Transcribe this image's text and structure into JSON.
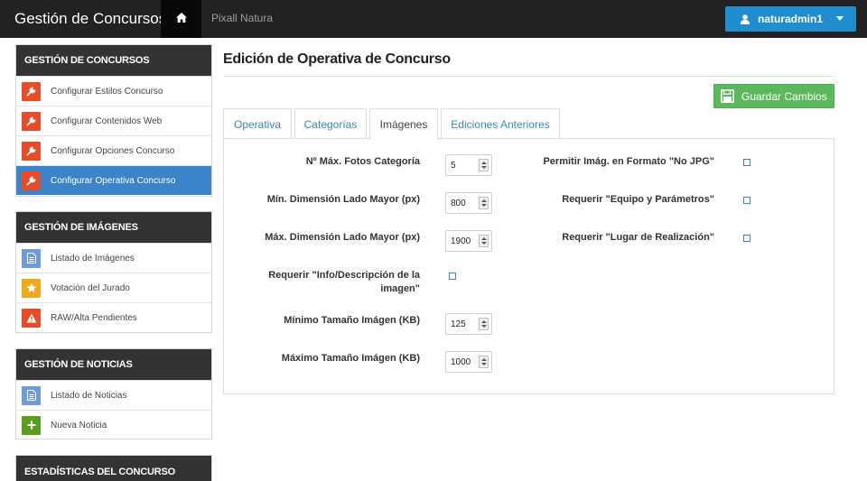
{
  "navbar": {
    "brand": "Gestión de Concursos",
    "home_icon": "home-icon",
    "contest_name": "Pixall Natura",
    "user_name": "naturadmin1",
    "user_icon": "user-icon",
    "dropdown_icon": "caret-down-icon"
  },
  "sidebar": {
    "sections": [
      {
        "title": "GESTIÓN DE CONCURSOS",
        "items": [
          {
            "label": "Configurar Estilos Concurso",
            "icon": "wrench-icon"
          },
          {
            "label": "Configurar Contenidos Web",
            "icon": "wrench-icon"
          },
          {
            "label": "Configurar Opciones Concurso",
            "icon": "wrench-icon"
          },
          {
            "label": "Configurar Operativa Concurso",
            "icon": "wrench-icon",
            "active": true
          }
        ]
      },
      {
        "title": "GESTIÓN DE IMÁGENES",
        "items": [
          {
            "label": "Listado de Imágenes",
            "icon": "document-icon"
          },
          {
            "label": "Votación del Jurado",
            "icon": "star-icon"
          },
          {
            "label": "RAW/Alta Pendientes",
            "icon": "warning-icon"
          }
        ]
      },
      {
        "title": "GESTIÓN DE NOTICIAS",
        "items": [
          {
            "label": "Listado de Noticias",
            "icon": "document-icon"
          },
          {
            "label": "Nueva Noticia",
            "icon": "plus-icon"
          }
        ]
      },
      {
        "title": "ESTADÍSTICAS DEL CONCURSO",
        "items": []
      }
    ]
  },
  "main": {
    "title": "Edición de Operativa de Concurso",
    "save_button": "Guardar Cambios",
    "save_icon": "floppy-disk-icon",
    "tabs": [
      {
        "label": "Operativa"
      },
      {
        "label": "Categorías"
      },
      {
        "label": "Imágenes",
        "active": true
      },
      {
        "label": "Ediciones Anteriores"
      }
    ],
    "fields": {
      "max_photos": {
        "label": "Nº Máx. Fotos Categoría",
        "value": "5"
      },
      "min_dimension": {
        "label": "Mín. Dimensión Lado Mayor (px)",
        "value": "800"
      },
      "max_dimension": {
        "label": "Máx. Dimensión Lado Mayor (px)",
        "value": "1900"
      },
      "require_info": {
        "label_line1": "Requerir \"Info/Descripción de la",
        "label_line2": "imagen\"",
        "checked": false
      },
      "min_size": {
        "label": "Mínimo Tamaño Imágen (KB)",
        "value": "125"
      },
      "max_size": {
        "label": "Máximo Tamaño Imágen (KB)",
        "value": "1000"
      },
      "allow_non_jpg": {
        "label": "Permitir Imág. en Formato \"No JPG\"",
        "checked": false
      },
      "require_equipment": {
        "label": "Requerir \"Equipo y Parámetros\"",
        "checked": false
      },
      "require_location": {
        "label": "Requerir \"Lugar de Realización\"",
        "checked": false
      }
    }
  },
  "colors": {
    "navbar": "#222222",
    "user_button": "#1f8ecf",
    "active_item": "#3c84c9",
    "save_button": "#5cb85c",
    "icon_red": "#e84c26",
    "icon_blue": "#6f9bd8",
    "icon_yellow": "#f2a81d",
    "icon_green": "#5b9e1f"
  }
}
